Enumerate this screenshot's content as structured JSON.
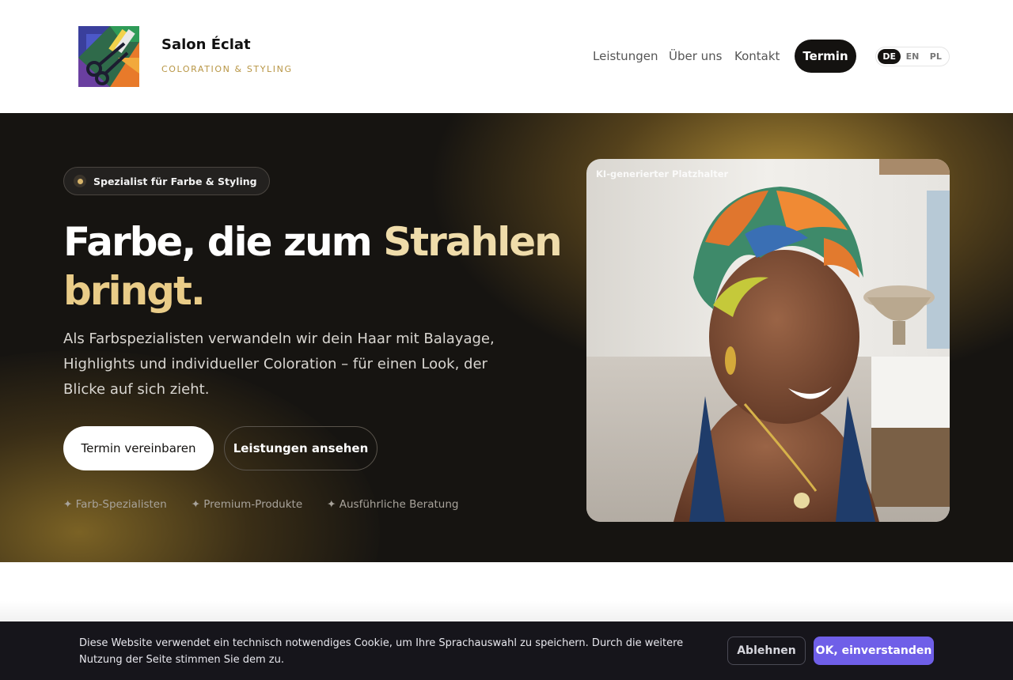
{
  "header": {
    "brand_name": "Salon Éclat",
    "brand_tagline": "COLORATION & STYLING",
    "nav": [
      {
        "label": "Leistungen"
      },
      {
        "label": "Über uns"
      },
      {
        "label": "Kontakt"
      }
    ],
    "cta_label": "Termin",
    "languages": [
      "DE",
      "EN",
      "PL"
    ],
    "active_language": "DE"
  },
  "hero": {
    "badge": "Spezialist für Farbe & Styling",
    "headline_part1": "Farbe, die zum ",
    "headline_highlight1": "Strahlen",
    "headline_highlight2": "bringt.",
    "lead": "Als Farbspezialisten verwandeln wir dein Haar mit Balayage, Highlights und individueller Coloration – für einen Look, der Blicke auf sich zieht.",
    "primary_button": "Termin vereinbaren",
    "secondary_button": "Leistungen ansehen",
    "features": [
      "✦ Farb-Spezialisten",
      "✦ Premium-Produkte",
      "✦ Ausführliche Beratung"
    ],
    "image_label": "KI-generierter Platzhalter"
  },
  "cookie": {
    "text": "Diese Website verwendet ein technisch notwendiges Cookie, um Ihre Sprachauswahl zu speichern. Durch die weitere Nutzung der Seite stimmen Sie dem zu.",
    "decline": "Ablehnen",
    "accept": "OK, einverstanden"
  },
  "colors": {
    "accent_gold": "#e9cc88",
    "hero_bg": "#161411",
    "cookie_accept": "#6f5fe8"
  }
}
